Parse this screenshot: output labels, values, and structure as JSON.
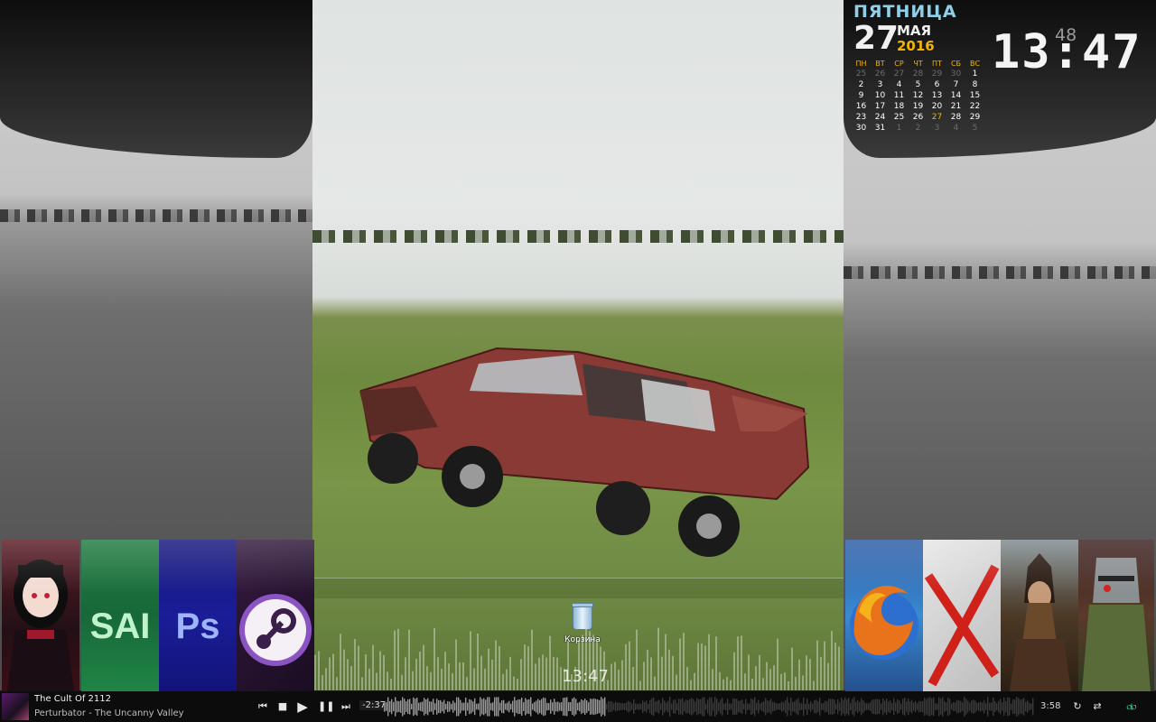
{
  "widget": {
    "weekday": "ПЯТНИЦА",
    "day": "27",
    "month": "МАЯ",
    "year": "2016",
    "time": "13:47",
    "seconds": "48",
    "calendar": {
      "headers": [
        "ПН",
        "ВТ",
        "СР",
        "ЧТ",
        "ПТ",
        "СБ",
        "ВС"
      ],
      "rows": [
        [
          "25",
          "26",
          "27",
          "28",
          "29",
          "30",
          "1"
        ],
        [
          "2",
          "3",
          "4",
          "5",
          "6",
          "7",
          "8"
        ],
        [
          "9",
          "10",
          "11",
          "12",
          "13",
          "14",
          "15"
        ],
        [
          "16",
          "17",
          "18",
          "19",
          "20",
          "21",
          "22"
        ],
        [
          "23",
          "24",
          "25",
          "26",
          "27",
          "28",
          "29"
        ],
        [
          "30",
          "31",
          "1",
          "2",
          "3",
          "4",
          "5"
        ]
      ],
      "today": "27"
    }
  },
  "desktop": {
    "recycle_bin_label": "Корзина",
    "center_clock": "13:47"
  },
  "tiles_left": [
    "anime-girl",
    "SAI",
    "Ps",
    "steam"
  ],
  "tiles_right": [
    "firefox",
    "xsplit",
    "game-warrior",
    "game-knight"
  ],
  "tile_text": {
    "sai": "SAI",
    "ps": "Ps"
  },
  "player": {
    "title": "The Cult Of 2112",
    "artist": "Perturbator - The Uncanny Valley",
    "elapsed": "-2:37",
    "total": "3:58",
    "icons": {
      "prev": "prev-icon",
      "stop": "stop-icon",
      "play": "play-icon",
      "pause": "pause-icon",
      "next": "next-icon",
      "repeat": "repeat-icon",
      "shuffle": "shuffle-icon",
      "winamp": "winamp-icon"
    },
    "progress": 0.34
  },
  "colors": {
    "accent": "#f2b500",
    "weekday": "#8fd0e8",
    "winamp": "#3dd5a0"
  }
}
